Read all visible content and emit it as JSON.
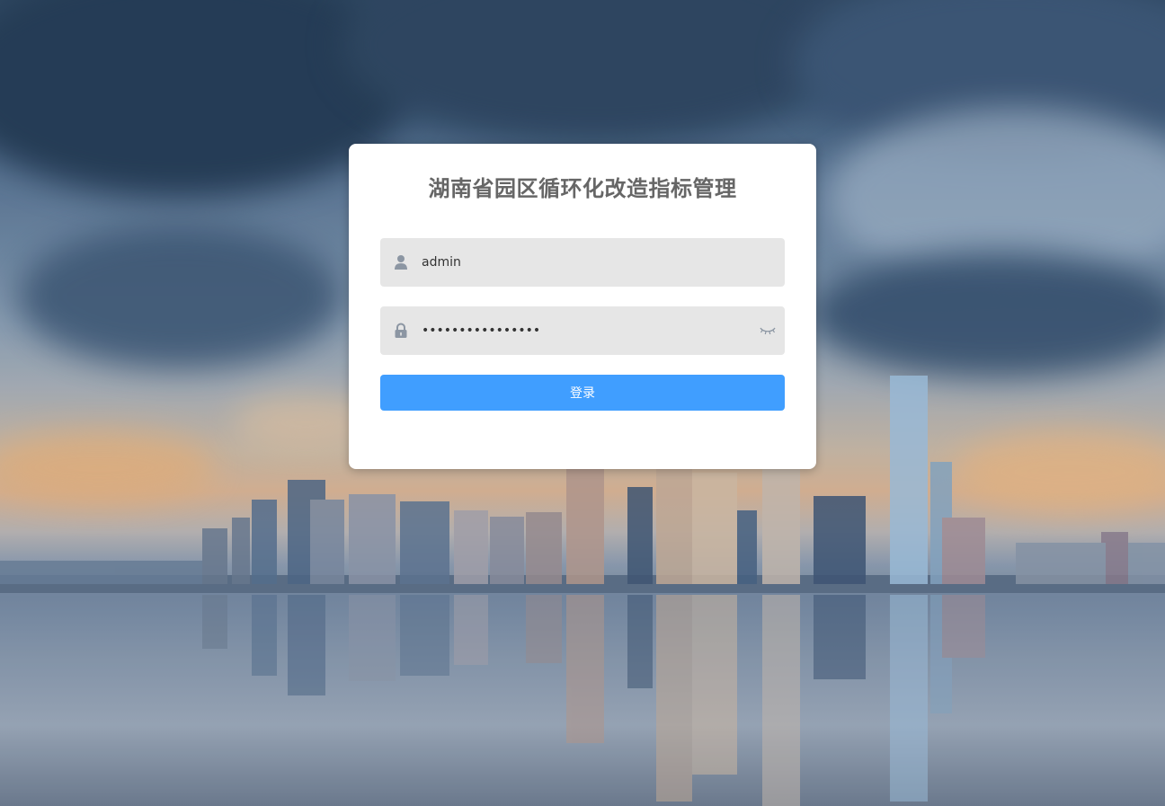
{
  "login": {
    "title": "湖南省园区循环化改造指标管理",
    "username_value": "admin",
    "password_value": "••••••••••••••••",
    "submit_label": "登录"
  },
  "icons": {
    "username": "user-icon",
    "password": "lock-icon",
    "visibility": "eye-closed-icon"
  },
  "colors": {
    "primary_button": "#409eff",
    "input_background": "#e6e6e6",
    "title_text": "#666666",
    "icon": "#8c96a3"
  }
}
